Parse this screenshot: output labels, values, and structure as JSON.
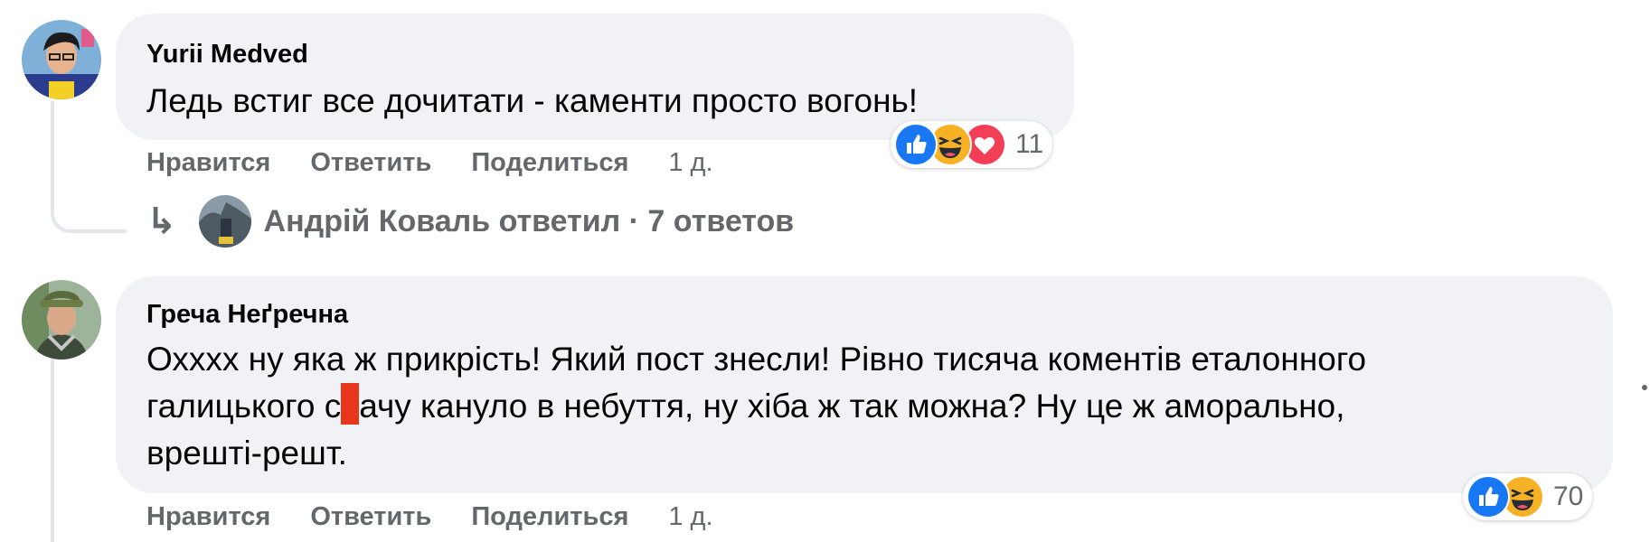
{
  "comments": [
    {
      "author": "Yurii Medved",
      "text": "Ледь встиг все дочитати - каменти просто вогонь!",
      "actions": {
        "like": "Нравится",
        "reply": "Ответить",
        "share": "Поделиться",
        "time": "1 д."
      },
      "reactions": {
        "icons": [
          "like-icon",
          "haha-icon",
          "love-icon"
        ],
        "count": "11"
      },
      "replies": {
        "replier": "Андрій Коваль",
        "summary": "Андрій Коваль ответил · 7 ответов"
      }
    },
    {
      "author": "Греча Неґречна",
      "text_line1": "Охххх ну яка ж прикрість! Який пост знесли! Рівно тисяча коментів еталонного",
      "text_line2_before": "галицького с",
      "text_line2_after": "ачу кануло в небуття, ну хіба ж так можна? Ну це ж аморально,",
      "text_line3": "врешті-решт.",
      "actions": {
        "like": "Нравится",
        "reply": "Ответить",
        "share": "Поделиться",
        "time": "1 д."
      },
      "reactions": {
        "icons": [
          "like-icon",
          "haha-icon"
        ],
        "count": "70"
      }
    }
  ],
  "colors": {
    "bubble": "#f0f2f5",
    "secondary_text": "#65676b",
    "like_blue": "#1877f2",
    "haha_yellow": "#f7b125",
    "love_red": "#f33e58",
    "censor": "#e8361c"
  }
}
